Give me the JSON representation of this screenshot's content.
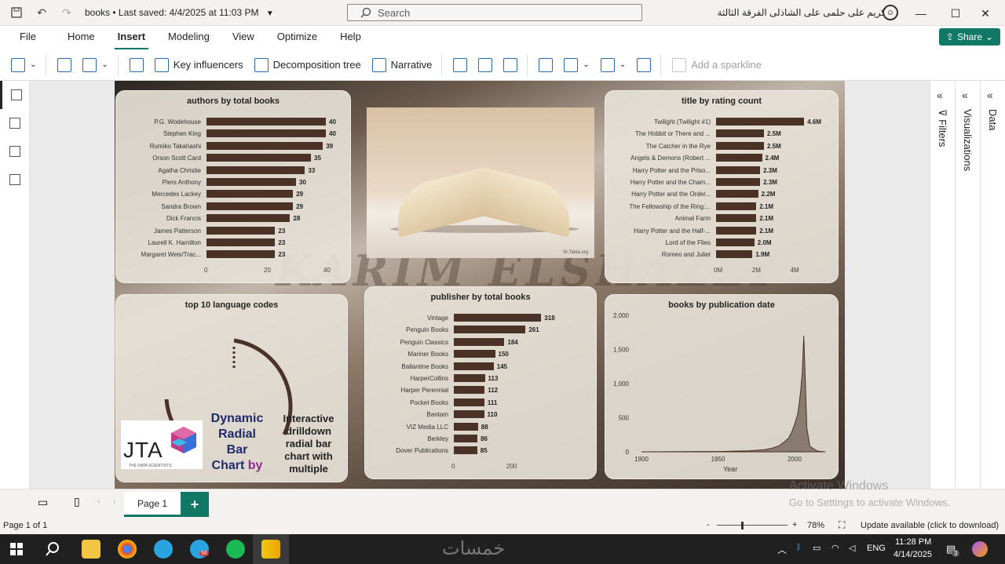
{
  "titlebar": {
    "doc_name": "books",
    "saved": "• Last saved: 4/4/2025 at 11:03 PM",
    "search_placeholder": "Search",
    "user_name": "كريم على حلمى على الشاذلى الفرقة الثالثة"
  },
  "menu": {
    "items": [
      "File",
      "Home",
      "Insert",
      "Modeling",
      "View",
      "Optimize",
      "Help"
    ],
    "share": "Share"
  },
  "ribbon": {
    "key_influencers": "Key influencers",
    "decomposition_tree": "Decomposition tree",
    "narrative": "Narrative",
    "add_sparkline": "Add a sparkline"
  },
  "panes": {
    "filters": "Filters",
    "visualizations": "Visualizations",
    "data": "Data"
  },
  "report": {
    "watermark": "KARIM ELSHAZLY",
    "photo_credit": "St-Takla.org",
    "jta_logo": "JTA",
    "jta_sub": "THE DATA SCIENTISTS",
    "dynamic_line1": "Dynamic",
    "dynamic_line2": "Radial",
    "dynamic_line3": "Bar",
    "dynamic_line4": "Chart",
    "dynamic_by": "by",
    "interactive_text": "Interactive drilldown radial bar chart with multiple"
  },
  "chart_data": [
    {
      "type": "bar",
      "title": "authors by total books",
      "categories": [
        "P.G. Wodehouse",
        "Stephen King",
        "Rumiko Takahashi",
        "Orson Scott Card",
        "Agatha Christie",
        "Piers Anthony",
        "Mercedes Lackey",
        "Sandra Brown",
        "Dick Francis",
        "James Patterson",
        "Laurell K. Hamilton",
        "Margaret Weis/Trac..."
      ],
      "values": [
        40,
        40,
        39,
        35,
        33,
        30,
        29,
        29,
        28,
        23,
        23,
        23
      ],
      "value_labels": [
        "40",
        "40",
        "39",
        "35",
        "33",
        "30",
        "29",
        "29",
        "28",
        "23",
        "23",
        "23"
      ],
      "xticks": [
        "0",
        "20",
        "40"
      ],
      "xlim": [
        0,
        40
      ]
    },
    {
      "type": "bar",
      "title": "title by rating count",
      "categories": [
        "Twilight (Twilight #1)",
        "The Hobbit or There and ...",
        "The Catcher in the Rye",
        "Angels & Demons (Robert ...",
        "Harry Potter and the Priso...",
        "Harry Potter and the Cham...",
        "Harry Potter and the Order...",
        "The Fellowship of the Ring:...",
        "Animal Farm",
        "Harry Potter and the Half-...",
        "Lord of the Flies",
        "Romeo and Juliet"
      ],
      "values": [
        4.6,
        2.5,
        2.5,
        2.4,
        2.3,
        2.3,
        2.2,
        2.1,
        2.1,
        2.1,
        2.0,
        1.9
      ],
      "value_labels": [
        "4.6M",
        "2.5M",
        "2.5M",
        "2.4M",
        "2.3M",
        "2.3M",
        "2.2M",
        "2.1M",
        "2.1M",
        "2.1M",
        "2.0M",
        "1.9M"
      ],
      "xticks": [
        "0M",
        "2M",
        "4M"
      ],
      "xlim": [
        0,
        5
      ]
    },
    {
      "type": "bar",
      "title": "publisher by total books",
      "categories": [
        "Vintage",
        "Penguin Books",
        "Penguin Classics",
        "Mariner Books",
        "Ballantine Books",
        "HarperCollins",
        "Harper Perennial",
        "Pocket Books",
        "Bantam",
        "VIZ Media LLC",
        "Berkley",
        "Dover Publications"
      ],
      "values": [
        318,
        261,
        184,
        150,
        145,
        113,
        112,
        111,
        110,
        88,
        86,
        85
      ],
      "value_labels": [
        "318",
        "261",
        "184",
        "150",
        "145",
        "113",
        "112",
        "111",
        "110",
        "88",
        "86",
        "85"
      ],
      "xticks": [
        "0",
        "200"
      ],
      "xlim": [
        0,
        400
      ]
    },
    {
      "type": "area",
      "title": "books by publication date",
      "xlabel": "Year",
      "xticks": [
        "1900",
        "1950",
        "2000"
      ],
      "yticks": [
        "0",
        "500",
        "1,000",
        "1,500",
        "2,000"
      ],
      "xlim": [
        1900,
        2020
      ],
      "ylim": [
        0,
        2000
      ],
      "x": [
        1900,
        1950,
        1970,
        1980,
        1985,
        1990,
        1993,
        1996,
        1998,
        2000,
        2002,
        2003,
        2004,
        2005,
        2006,
        2007,
        2008,
        2010,
        2015,
        2020
      ],
      "y": [
        0,
        5,
        15,
        30,
        50,
        90,
        140,
        200,
        280,
        400,
        550,
        700,
        900,
        1150,
        1700,
        1050,
        350,
        80,
        10,
        0
      ]
    },
    {
      "type": "radial_bar",
      "title": "top 10 language codes"
    }
  ],
  "pagebar": {
    "page_tab": "Page 1",
    "add": "+"
  },
  "statusbar": {
    "page_info": "Page 1 of 1",
    "zoom": "78%",
    "update": "Update available (click to download)"
  },
  "activation": {
    "line1": "Activate Windows",
    "line2": "Go to Settings to activate Windows."
  },
  "taskbar": {
    "lang": "ENG",
    "time": "11:28 PM",
    "date": "4/14/2025",
    "telegram_badge": "56",
    "notif_count": "3",
    "center_logo": "خمسات"
  },
  "colors": {
    "accent": "#117865",
    "bar": "#4a3226",
    "card": "#e6e1d7"
  }
}
